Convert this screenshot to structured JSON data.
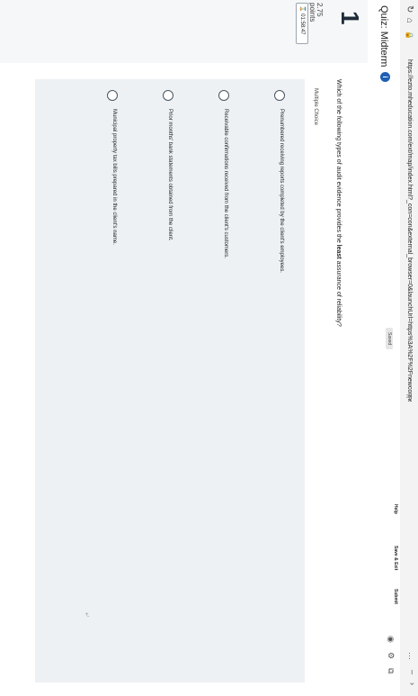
{
  "browser": {
    "url": "https://ezto.mheducation.com/ext/map/index.html?_con=con&external_browser=0&launchUrl=https%3A%2F%2Fnewconnect.mheducation.com..."
  },
  "header": {
    "quiz_title": "Quiz: Midterm",
    "saved_label": "Saved",
    "help_label": "Help",
    "save_exit_label": "Save & Exit",
    "submit_label": "Submit"
  },
  "question": {
    "number": "1",
    "points_value": "2.75",
    "points_label": "points",
    "id_label": "01:58:47",
    "type_label": "Multiple Choice",
    "text_prefix": "Which of the following types of audit evidence provides the ",
    "text_bold": "least",
    "text_suffix": " assurance of reliability?",
    "options": [
      "Prenumbered receiving reports completed by the client's employees.",
      "Receivable confirmations received from the client's customers.",
      "Prior months' bank statements obtained from the client.",
      "Municipal property tax bills prepared in the client's name."
    ]
  }
}
